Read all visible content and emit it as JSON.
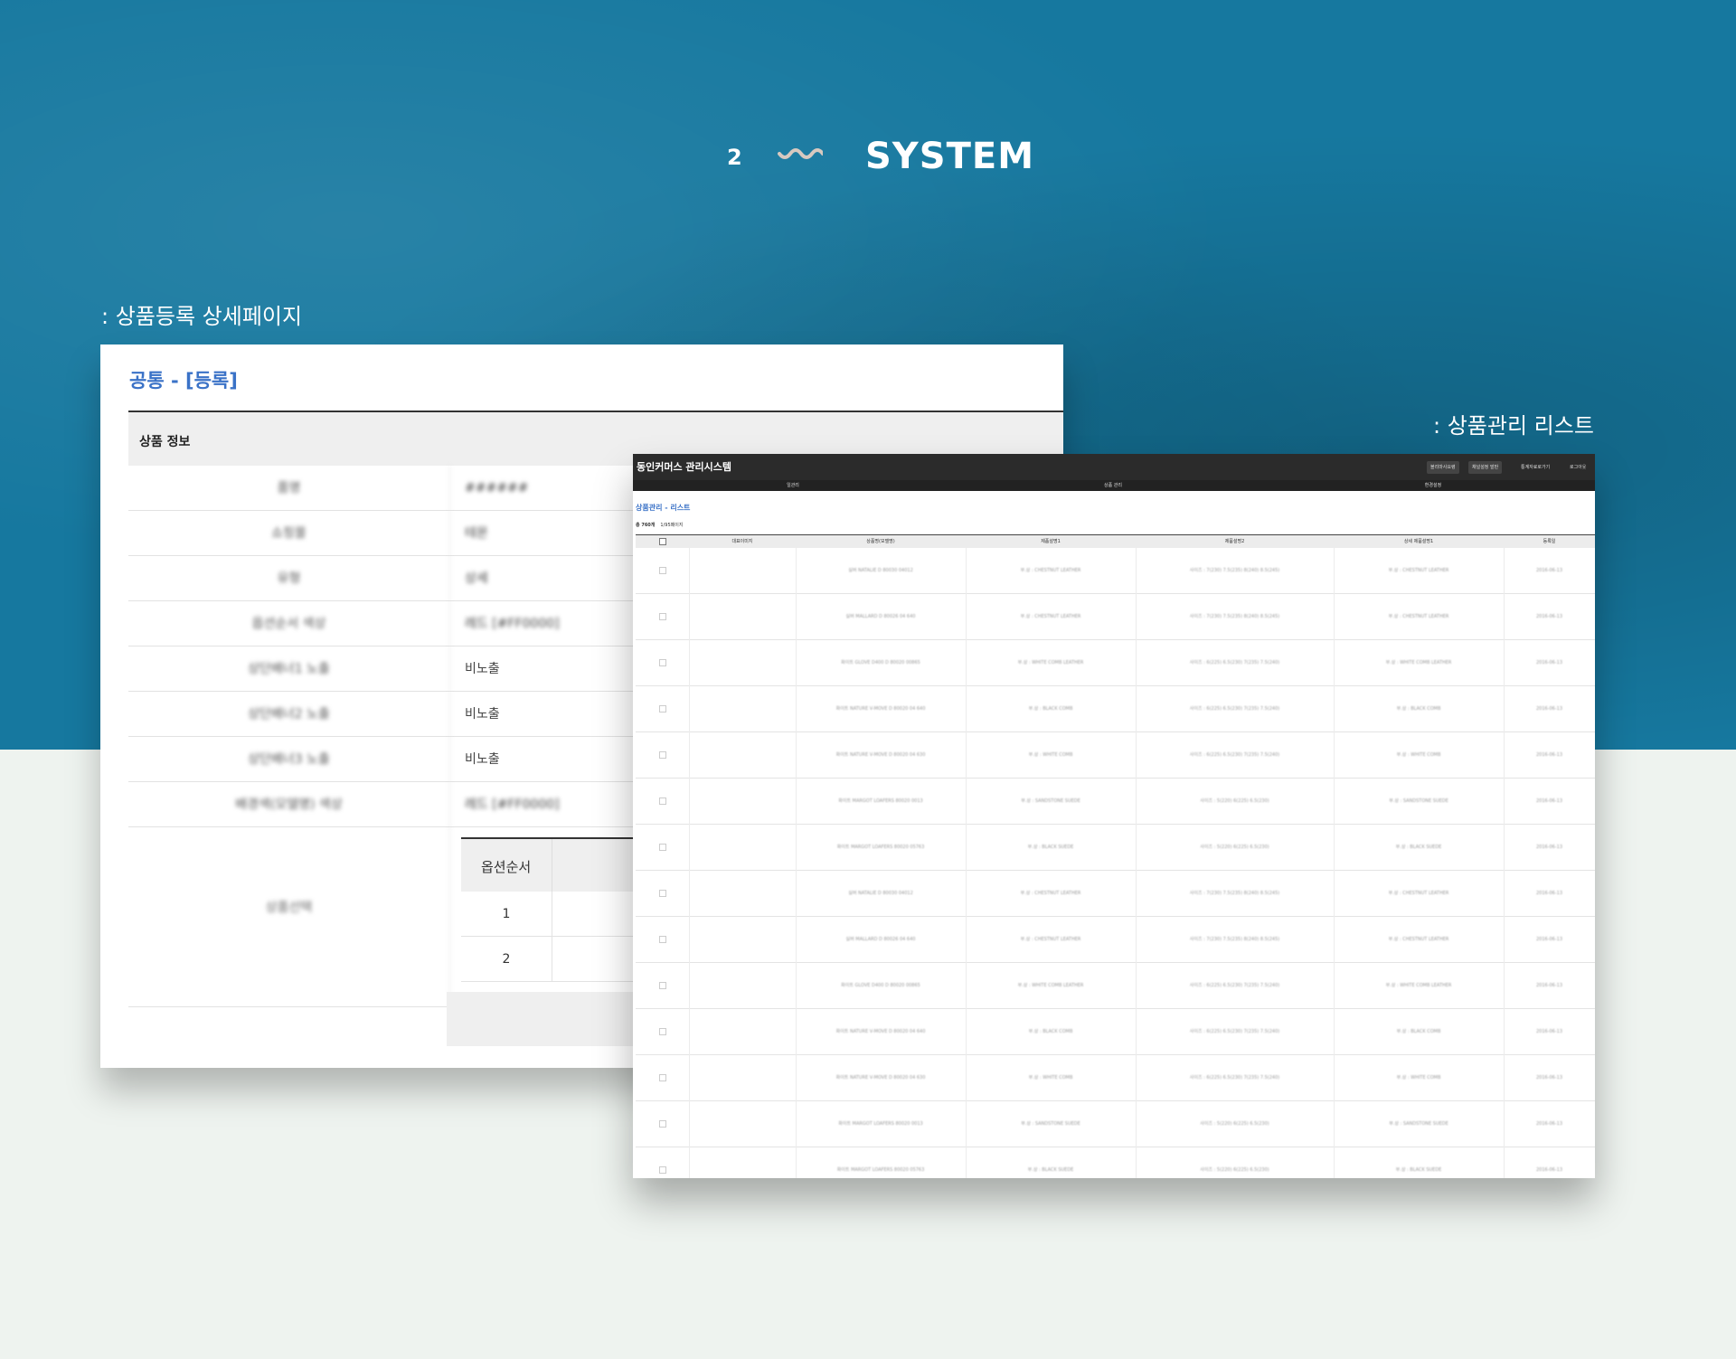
{
  "heading": {
    "number": "2",
    "title": "SYSTEM"
  },
  "captions": {
    "detail": ": 상품등록 상세페이지",
    "list": ": 상품관리 리스트"
  },
  "detail": {
    "title": "공통 - [등록]",
    "section": "상품 정보",
    "rows": [
      {
        "label": "품명",
        "value": "######"
      },
      {
        "label": "쇼핑몰",
        "value": "테몬"
      },
      {
        "label": "유형",
        "value": "상세"
      },
      {
        "label": "옵션순서 색상",
        "value": "레드 [#FF0000]"
      },
      {
        "label": "상단배너1 노출",
        "value": "비노출"
      },
      {
        "label": "상단배너2 노출",
        "value": "비노출"
      },
      {
        "label": "상단배너3 노출",
        "value": "비노출"
      },
      {
        "label": "배경색(모델명) 색상",
        "value": "레드 [#FF0000]"
      }
    ],
    "option_label": "상품선택",
    "option_table": {
      "header": "옵션순서",
      "rows": [
        "1",
        "2"
      ]
    }
  },
  "list": {
    "brand": "동인커머스 관리시스템",
    "top_buttons": [
      "블리마사요령",
      "채널설정 발판",
      "통계자료로가기",
      "로그아웃"
    ],
    "nav": [
      "일관리",
      "상품 관리",
      "환경설정"
    ],
    "breadcrumb": "상품관리 - 리스트",
    "count_label": "총 760개",
    "page_label": "1/95페이지",
    "columns": [
      "대표이미지",
      "상품명(모델명)",
      "제품설명1",
      "제품설명2",
      "상세 제품설명1",
      "등록일"
    ],
    "rows": [
      [
        "실버 NATALIE D 80030 04012",
        "부.상 : CHESTNUT LEATHER",
        "사이즈 : 7(230) 7.5(235) 8(240) 8.5(245)",
        "부.상 : CHESTNUT LEATHER",
        "2016-06-13"
      ],
      [
        "실버 MALLARD D 80026 04 640",
        "부.상 : CHESTNUT LEATHER",
        "사이즈 : 7(230) 7.5(235) 8(240) 8.5(245)",
        "부.상 : CHESTNUT LEATHER",
        "2016-06-13"
      ],
      [
        "화이트 GLOVE D400 D 80020 00865",
        "부.상 : WHITE COMB LEATHER",
        "사이즈 : 6(225) 6.5(230) 7(235) 7.5(240)",
        "부.상 : WHITE COMB LEATHER",
        "2016-06-13"
      ],
      [
        "화이트 NATURE V-MOVE D 80020 04 640",
        "부.상 : BLACK COMB",
        "사이즈 : 6(225) 6.5(230) 7(235) 7.5(240)",
        "부.상 : BLACK COMB",
        "2016-06-13"
      ],
      [
        "화이트 NATURE V-MOVE D 80020 04 630",
        "부.상 : WHITE COMB",
        "사이즈 : 6(225) 6.5(230) 7(235) 7.5(240)",
        "부.상 : WHITE COMB",
        "2016-06-13"
      ],
      [
        "화이트 MARGOT LOAFERS 80020 0013",
        "부.상 : SANDSTONE SUEDE",
        "사이즈 : 5(220) 6(225) 6.5(230)",
        "부.상 : SANDSTONE SUEDE",
        "2016-06-13"
      ],
      [
        "화이트 MARGOT LOAFERS 80020 05763",
        "부.상 : BLACK SUEDE",
        "사이즈 : 5(220) 6(225) 6.5(230)",
        "부.상 : BLACK SUEDE",
        "2016-06-13"
      ],
      [
        "실버 NATALIE D 80030 04012",
        "부.상 : CHESTNUT LEATHER",
        "사이즈 : 7(230) 7.5(235) 8(240) 8.5(245)",
        "부.상 : CHESTNUT LEATHER",
        "2016-06-13"
      ],
      [
        "실버 MALLARD D 80026 04 640",
        "부.상 : CHESTNUT LEATHER",
        "사이즈 : 7(230) 7.5(235) 8(240) 8.5(245)",
        "부.상 : CHESTNUT LEATHER",
        "2016-06-13"
      ],
      [
        "화이트 GLOVE D400 D 80020 00865",
        "부.상 : WHITE COMB LEATHER",
        "사이즈 : 6(225) 6.5(230) 7(235) 7.5(240)",
        "부.상 : WHITE COMB LEATHER",
        "2016-06-13"
      ],
      [
        "화이트 NATURE V-MOVE D 80020 04 640",
        "부.상 : BLACK COMB",
        "사이즈 : 6(225) 6.5(230) 7(235) 7.5(240)",
        "부.상 : BLACK COMB",
        "2016-06-13"
      ],
      [
        "화이트 NATURE V-MOVE D 80020 04 630",
        "부.상 : WHITE COMB",
        "사이즈 : 6(225) 6.5(230) 7(235) 7.5(240)",
        "부.상 : WHITE COMB",
        "2016-06-13"
      ],
      [
        "화이트 MARGOT LOAFERS 80020 0013",
        "부.상 : SANDSTONE SUEDE",
        "사이즈 : 5(220) 6(225) 6.5(230)",
        "부.상 : SANDSTONE SUEDE",
        "2016-06-13"
      ],
      [
        "화이트 MARGOT LOAFERS 80020 05763",
        "부.상 : BLACK SUEDE",
        "사이즈 : 5(220) 6(225) 6.5(230)",
        "부.상 : BLACK SUEDE",
        "2016-06-13"
      ]
    ]
  },
  "colors": {
    "background_top": "#16789f",
    "background_bottom": "#eef3ef",
    "accent": "#3a72c7",
    "admin_bar": "#2b2b2b"
  }
}
